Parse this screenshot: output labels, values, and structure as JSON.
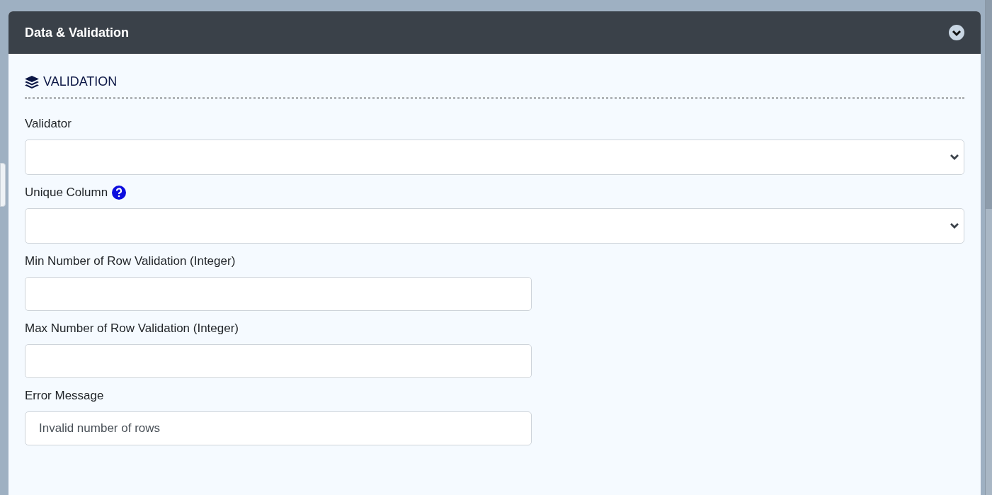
{
  "panel": {
    "title": "Data & Validation",
    "expanded": true
  },
  "section": {
    "title": "VALIDATION"
  },
  "fields": [
    {
      "kind": "select",
      "label": "Validator",
      "help": false
    },
    {
      "kind": "select",
      "label": "Unique Column",
      "help": true
    },
    {
      "kind": "text",
      "label": "Min Number of Row Validation (Integer)",
      "help": false
    },
    {
      "kind": "text",
      "label": "Max Number of Row Validation (Integer)",
      "help": false
    },
    {
      "kind": "text",
      "label": "Error Message",
      "help": false,
      "value": "Invalid number of rows"
    }
  ]
}
